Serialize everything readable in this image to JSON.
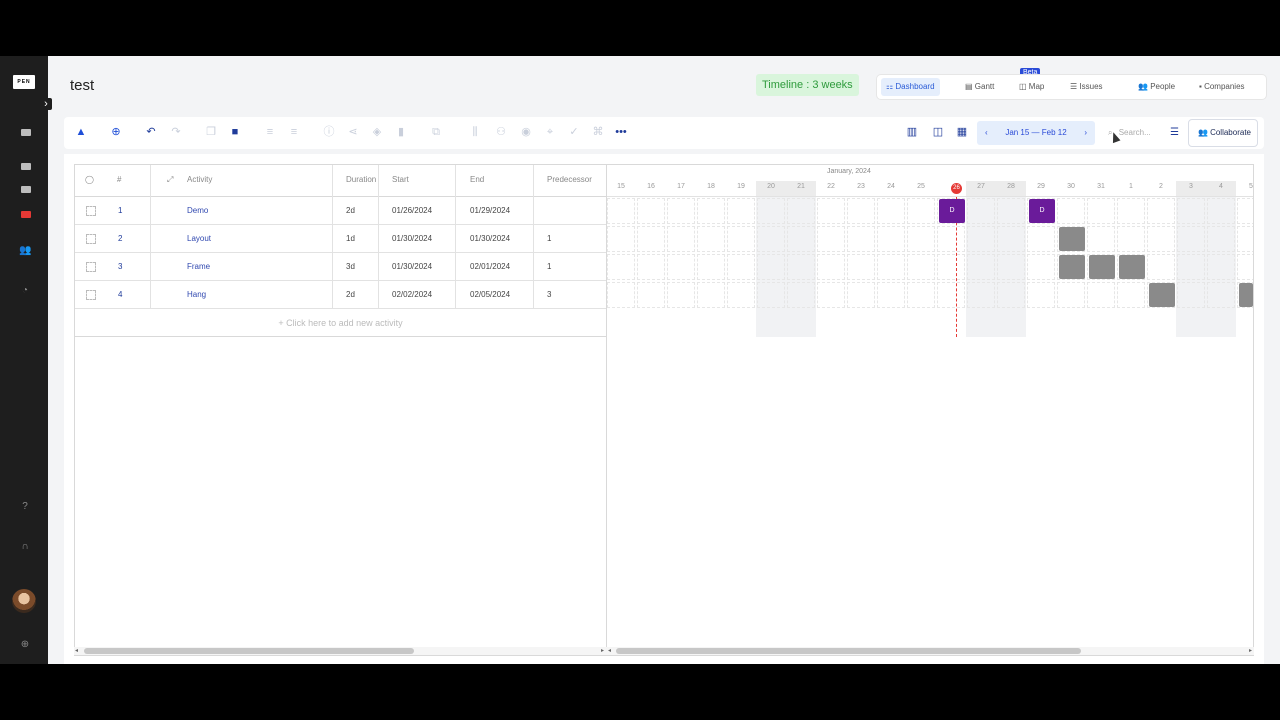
{
  "app": {
    "logo_text": "PEN"
  },
  "page": {
    "title": "test"
  },
  "timeline_badge": "Timeline : 3 weeks",
  "view_tabs": [
    {
      "label": "Dashboard",
      "active": true
    },
    {
      "label": "Gantt",
      "active": false
    },
    {
      "label": "Map",
      "active": false,
      "badge": "Beta"
    },
    {
      "label": "Issues",
      "active": false
    },
    {
      "label": "People",
      "active": false
    },
    {
      "label": "Companies",
      "active": false
    }
  ],
  "toolbar": {
    "date_range": "Jan 15 — Feb 12",
    "prev": "‹",
    "next": "›",
    "search_placeholder": "Search...",
    "collaborate": "Collaborate"
  },
  "grid": {
    "headers": {
      "num": "#",
      "activity": "Activity",
      "duration": "Duration",
      "start": "Start",
      "end": "End",
      "predecessor": "Predecessor"
    },
    "rows": [
      {
        "num": "1",
        "activity": "Demo",
        "duration": "2d",
        "start": "01/26/2024",
        "end": "01/29/2024",
        "predecessor": ""
      },
      {
        "num": "2",
        "activity": "Layout",
        "duration": "1d",
        "start": "01/30/2024",
        "end": "01/30/2024",
        "predecessor": "1"
      },
      {
        "num": "3",
        "activity": "Frame",
        "duration": "3d",
        "start": "01/30/2024",
        "end": "02/01/2024",
        "predecessor": "1"
      },
      {
        "num": "4",
        "activity": "Hang",
        "duration": "2d",
        "start": "02/02/2024",
        "end": "02/05/2024",
        "predecessor": "3"
      }
    ],
    "add_row": "+ Click here to add new activity"
  },
  "gantt": {
    "month": "January, 2024",
    "days": [
      "15",
      "16",
      "17",
      "18",
      "19",
      "20",
      "21",
      "22",
      "23",
      "24",
      "25",
      "26",
      "27",
      "28",
      "29",
      "30",
      "31",
      "1",
      "2",
      "3",
      "4",
      "5"
    ],
    "today": "26",
    "bar_label": "D"
  },
  "colors": {
    "accent": "#1f4fd8",
    "today": "#e53935",
    "milestone": "#6a1b9a",
    "task": "#8a8a8a"
  }
}
